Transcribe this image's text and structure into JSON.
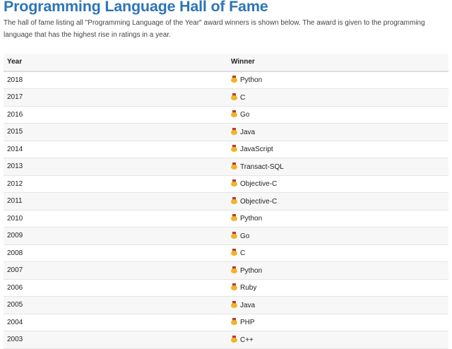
{
  "title": "Programming Language Hall of Fame",
  "description": "The hall of fame listing all \"Programming Language of the Year\" award winners is shown below. The award is given to the programming language that has the highest rise in ratings in a year.",
  "table": {
    "headers": [
      "Year",
      "Winner"
    ],
    "rows": [
      {
        "year": "2018",
        "winner": "Python"
      },
      {
        "year": "2017",
        "winner": "C"
      },
      {
        "year": "2016",
        "winner": "Go"
      },
      {
        "year": "2015",
        "winner": "Java"
      },
      {
        "year": "2014",
        "winner": "JavaScript"
      },
      {
        "year": "2013",
        "winner": "Transact-SQL"
      },
      {
        "year": "2012",
        "winner": "Objective-C"
      },
      {
        "year": "2011",
        "winner": "Objective-C"
      },
      {
        "year": "2010",
        "winner": "Python"
      },
      {
        "year": "2009",
        "winner": "Go"
      },
      {
        "year": "2008",
        "winner": "C"
      },
      {
        "year": "2007",
        "winner": "Python"
      },
      {
        "year": "2006",
        "winner": "Ruby"
      },
      {
        "year": "2005",
        "winner": "Java"
      },
      {
        "year": "2004",
        "winner": "PHP"
      },
      {
        "year": "2003",
        "winner": "C++"
      }
    ]
  },
  "icon": "medal-icon",
  "colors": {
    "title": "#2e75b6"
  }
}
